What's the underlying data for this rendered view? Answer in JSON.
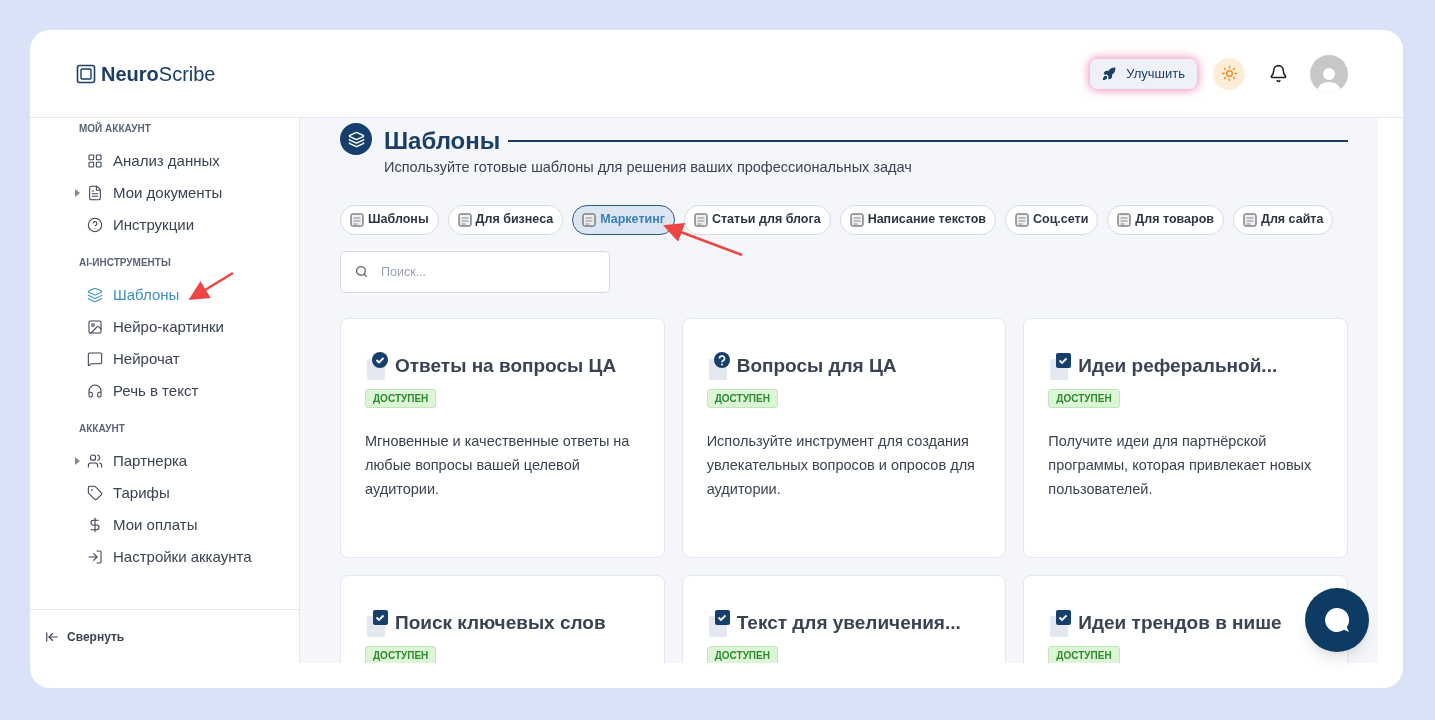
{
  "header": {
    "logo_bold": "Neuro",
    "logo_rest": "Scribe",
    "upgrade_button": "Улучшить"
  },
  "sidebar": {
    "sections": [
      {
        "title": "МОЙ АККАУНТ",
        "items": [
          {
            "label": "Анализ данных",
            "expandable": false,
            "selected": false
          },
          {
            "label": "Мои документы",
            "expandable": true,
            "selected": false
          },
          {
            "label": "Инструкции",
            "expandable": false,
            "selected": false
          }
        ]
      },
      {
        "title": "AI-ИНСТРУМЕНТЫ",
        "items": [
          {
            "label": "Шаблоны",
            "expandable": false,
            "selected": true
          },
          {
            "label": "Нейро-картинки",
            "expandable": false,
            "selected": false
          },
          {
            "label": "Нейрочат",
            "expandable": false,
            "selected": false
          },
          {
            "label": "Речь в текст",
            "expandable": false,
            "selected": false
          }
        ]
      },
      {
        "title": "АККАУНТ",
        "items": [
          {
            "label": "Партнерка",
            "expandable": true,
            "selected": false
          },
          {
            "label": "Тарифы",
            "expandable": false,
            "selected": false
          },
          {
            "label": "Мои оплаты",
            "expandable": false,
            "selected": false
          },
          {
            "label": "Настройки аккаунта",
            "expandable": false,
            "selected": false
          }
        ]
      }
    ],
    "collapse": "Свернуть"
  },
  "page": {
    "title": "Шаблоны",
    "subtitle": "Используйте готовые шаблоны для решения ваших профессиональных задач"
  },
  "tabs": [
    {
      "label": "Шаблоны",
      "selected": false
    },
    {
      "label": "Для бизнеса",
      "selected": false
    },
    {
      "label": "Маркетинг",
      "selected": true
    },
    {
      "label": "Статьи для блога",
      "selected": false
    },
    {
      "label": "Написание текстов",
      "selected": false
    },
    {
      "label": "Соц.сети",
      "selected": false
    },
    {
      "label": "Для товаров",
      "selected": false
    },
    {
      "label": "Для сайта",
      "selected": false
    }
  ],
  "search": {
    "placeholder": "Поиск..."
  },
  "cards": [
    {
      "kind": "check-circle",
      "title": "Ответы на вопросы ЦА",
      "badge": "ДОСТУПЕН",
      "description": "Мгновенные и качественные ответы на любые вопросы вашей целевой аудитории."
    },
    {
      "kind": "question",
      "title": "Вопросы для ЦА",
      "badge": "ДОСТУПЕН",
      "description": "Используйте инструмент для создания увлекательных вопросов и опросов для аудитории."
    },
    {
      "kind": "check-square",
      "title": "Идеи реферальной...",
      "badge": "ДОСТУПЕН",
      "description": "Получите идеи для партнёрской программы, которая привлекает новых пользователей."
    },
    {
      "kind": "check-square",
      "title": "Поиск ключевых слов",
      "badge": "ДОСТУПЕН"
    },
    {
      "kind": "check-square",
      "title": "Текст для увеличения...",
      "badge": "ДОСТУПЕН"
    },
    {
      "kind": "check-square",
      "title": "Идеи трендов в нише",
      "badge": "ДОСТУПЕН"
    }
  ]
}
